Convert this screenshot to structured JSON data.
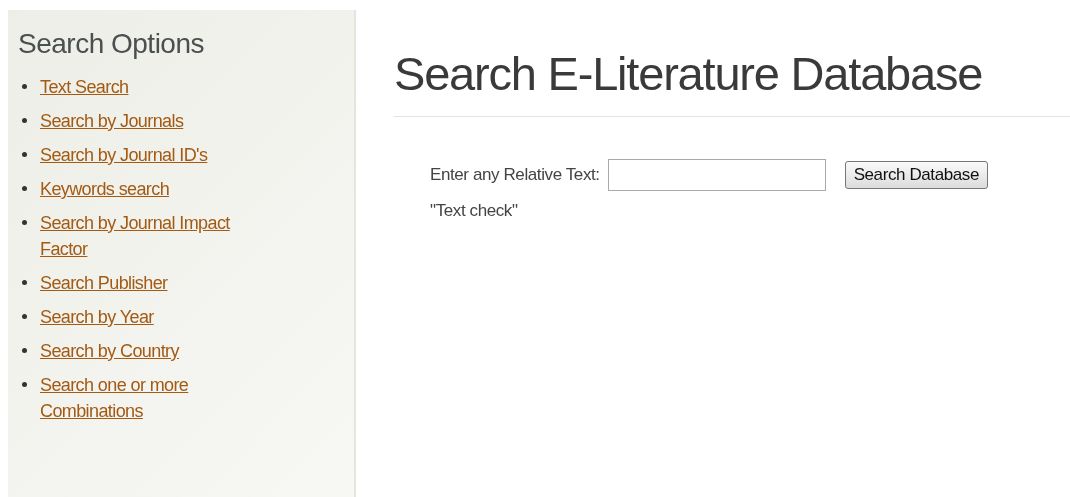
{
  "sidebar": {
    "title": "Search Options",
    "links": [
      {
        "label": "Text Search"
      },
      {
        "label": "Search by Journals"
      },
      {
        "label": "Search by Journal ID's"
      },
      {
        "label": "Keywords search"
      },
      {
        "label": "Search by Journal Impact Factor"
      },
      {
        "label": "Search Publisher"
      },
      {
        "label": "Search by Year"
      },
      {
        "label": "Search by Country"
      },
      {
        "label": "Search one or more Combinations"
      }
    ]
  },
  "main": {
    "title": "Search E-Literature Database",
    "field_label": "Enter any Relative Text:",
    "button": "Search Database",
    "result": "\"Text check\""
  }
}
